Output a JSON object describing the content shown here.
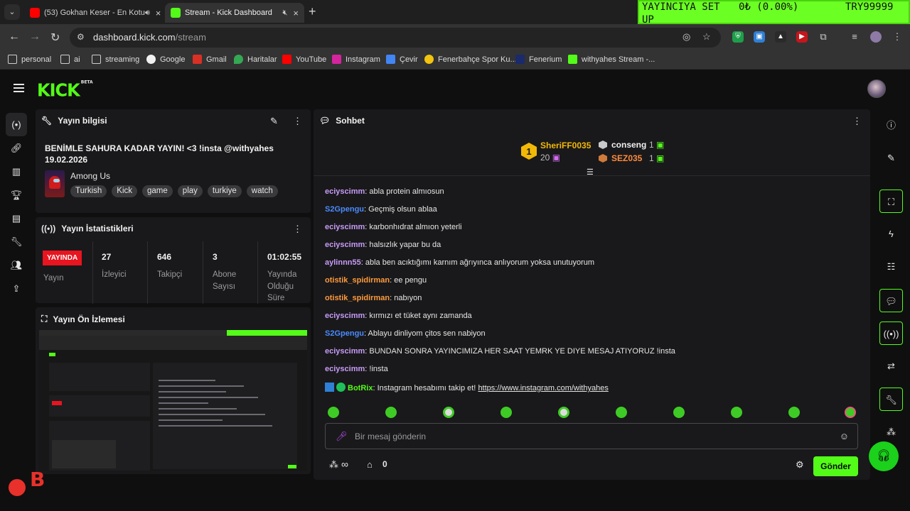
{
  "browser": {
    "tabs": [
      {
        "label": "(53) Gokhan Keser - En Kotu",
        "favicon_color": "#ff0000"
      },
      {
        "label": "Stream - Kick Dashboard",
        "favicon_color": "#53fc18"
      }
    ],
    "overlay": {
      "text1": "YAYINCIYA SET",
      "text2": "UP",
      "text3": "0₺ (0.00%)",
      "text4": "TRY99999"
    },
    "url_host": "dashboard.kick.com",
    "url_path": "/stream",
    "bookmarks": [
      {
        "label": "personal",
        "icon": "folder-icon"
      },
      {
        "label": "ai",
        "icon": "folder-icon"
      },
      {
        "label": "streaming",
        "icon": "folder-icon"
      },
      {
        "label": "Google",
        "icon": "google-icon"
      },
      {
        "label": "Gmail",
        "icon": "gmail-icon"
      },
      {
        "label": "Haritalar",
        "icon": "maps-icon"
      },
      {
        "label": "YouTube",
        "icon": "youtube-icon"
      },
      {
        "label": "Instagram",
        "icon": "instagram-icon"
      },
      {
        "label": "Çevir",
        "icon": "translate-icon"
      },
      {
        "label": "Fenerbahçe Spor Ku...",
        "icon": "fenerbahce-icon"
      },
      {
        "label": "Fenerium",
        "icon": "fenerium-icon"
      },
      {
        "label": "withyahes Stream -...",
        "icon": "kick-icon"
      }
    ]
  },
  "kick": {
    "logo": "KICK",
    "logo_badge": "BETA",
    "stream_info": {
      "heading": "Yayın bilgisi",
      "title_line1": "BENİMLE SAHURA KADAR YAYIN! <3 !insta @withyahes",
      "title_line2": "19.02.2026",
      "game": "Among Us",
      "tags": [
        "Turkish",
        "Kick",
        "game",
        "play",
        "turkiye",
        "watch"
      ]
    },
    "stats": {
      "heading": "Yayın İstatistikleri",
      "live_badge": "YAYINDA",
      "stream_label": "Yayın",
      "viewers_value": "27",
      "viewers_label": "İzleyici",
      "followers_value": "646",
      "followers_label": "Takipçi",
      "subs_value": "3",
      "subs_label_1": "Abone",
      "subs_label_2": "Sayısı",
      "uptime_value": "01:02:55",
      "uptime_label_1": "Yayında",
      "uptime_label_2": "Olduğu",
      "uptime_label_3": "Süre"
    },
    "preview": {
      "heading": "Yayın Ön İzlemesi"
    },
    "chat": {
      "heading": "Sohbet",
      "leaderboard": {
        "first_name": "SheriFF0035",
        "first_count": "20",
        "second_name": "conseng",
        "second_count": "1",
        "third_name": "SEZ035",
        "third_count": "1"
      },
      "messages": [
        {
          "user": "eciyscimm",
          "color": "#c89cf8",
          "text": "abla protein almıosun"
        },
        {
          "user": "S2Gpengu",
          "color": "#4a8bff",
          "text": "Geçmiş olsun ablaa"
        },
        {
          "user": "eciyscimm",
          "color": "#c89cf8",
          "text": "karbonhıdrat almıon yeterli"
        },
        {
          "user": "eciyscimm",
          "color": "#c89cf8",
          "text": "halsızlık yapar bu da"
        },
        {
          "user": "aylinnn55",
          "color": "#c89cf8",
          "text": "abla ben acıktığımı karnım ağrıyınca anlıyorum yoksa unutuyorum"
        },
        {
          "user": "otistik_spidirman",
          "color": "#ff9a3c",
          "text": "ee pengu"
        },
        {
          "user": "otistik_spidirman",
          "color": "#ff9a3c",
          "text": "nabıyon"
        },
        {
          "user": "eciyscimm",
          "color": "#c89cf8",
          "text": "kırmızı et tüket aynı zamanda"
        },
        {
          "user": "S2Gpengu",
          "color": "#4a8bff",
          "text": "Ablayu dinliyom çitos sen nabiyon"
        },
        {
          "user": "eciyscimm",
          "color": "#c89cf8",
          "text": "BUNDAN SONRA YAYINCIMIZA HER SAAT YEMRK YE DIYE MESAJ ATIYORUZ !insta"
        },
        {
          "user": "eciyscimm",
          "color": "#c89cf8",
          "text": "!insta"
        }
      ],
      "bot_message": {
        "user": "BotRix",
        "color": "#53fc18",
        "text": "Instagram hesabımı takip et!",
        "link": "https://www.instagram.com/withyahes"
      },
      "input_placeholder": "Bir mesaj gönderin",
      "points_value": "∞",
      "store_value": "0",
      "send_label": "Gönder"
    }
  }
}
